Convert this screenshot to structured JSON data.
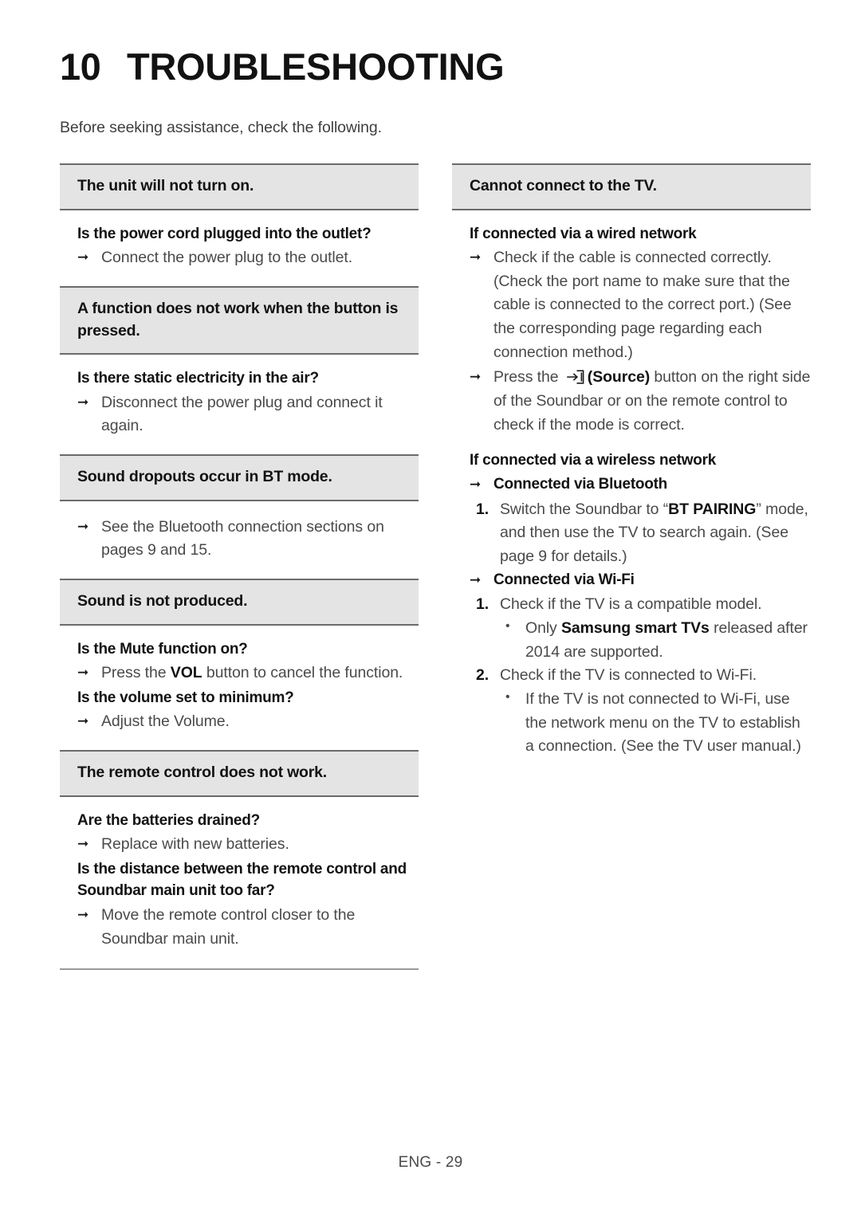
{
  "chapter": {
    "number": "10",
    "title": "TROUBLESHOOTING"
  },
  "intro": "Before seeking assistance, check the following.",
  "footer": "ENG - 29",
  "markers": {
    "arrow": "➞",
    "bullet": "•",
    "num1": "1.",
    "num2": "2.",
    "source_icon": "source-icon"
  },
  "left_column": {
    "sections": [
      {
        "heading": "The unit will not turn on.",
        "question": "Is the power cord plugged into the outlet?",
        "answer": "Connect the power plug to the outlet."
      },
      {
        "heading": "A function does not work when the button is pressed.",
        "question": "Is there static electricity in the air?",
        "answer": "Disconnect the power plug and connect it again."
      },
      {
        "heading": "Sound dropouts occur in BT mode.",
        "answer": "See the Bluetooth connection sections on pages 9 and 15."
      },
      {
        "heading": "Sound is not produced.",
        "question": "Is the Mute function on?",
        "answer_parts": {
          "pre": "Press the ",
          "bold": "VOL",
          "post": " button to cancel the function."
        },
        "question2": "Is the volume set to minimum?",
        "answer2": "Adjust the Volume."
      },
      {
        "heading": "The remote control does not work.",
        "question": "Are the batteries drained?",
        "answer": "Replace with new batteries.",
        "question2": "Is the distance between the remote control and Soundbar main unit too far?",
        "answer2": "Move the remote control closer to the Soundbar main unit."
      }
    ]
  },
  "right_column": {
    "heading": "Cannot connect to the TV.",
    "wired": {
      "title": "If connected via a wired network",
      "item1": "Check if the cable is connected correctly. (Check the port name to make sure that the cable is connected to the correct port.) (See the corresponding page regarding each connection method.)",
      "item2_parts": {
        "pre": "Press the ",
        "bold": "(Source)",
        "post": " button on the right side of the Soundbar or on the remote control to check if the mode is correct."
      }
    },
    "wireless": {
      "title": "If connected via a wireless network",
      "bluetooth": {
        "label": "Connected via Bluetooth",
        "step1_parts": {
          "pre": "Switch the Soundbar to “",
          "bold": "BT PAIRING",
          "post": "” mode, and then use the TV to search again. (See page 9 for details.)"
        }
      },
      "wifi": {
        "label": "Connected via Wi-Fi",
        "step1": "Check if the TV is a compatible model.",
        "step1_sub_parts": {
          "pre": "Only ",
          "bold": "Samsung smart TVs",
          "post": " released after 2014 are supported."
        },
        "step2": "Check if the TV is connected to Wi-Fi.",
        "step2_sub": "If the TV is not connected to Wi-Fi, use the network menu on the TV to establish a connection. (See the TV user manual.)"
      }
    }
  }
}
